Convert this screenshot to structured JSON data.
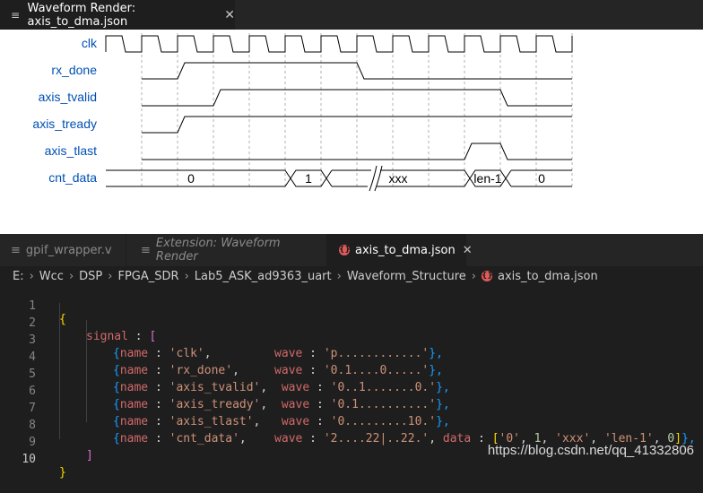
{
  "top_tab": {
    "icon": "preview-icon",
    "title": "Waveform Render: axis_to_dma.json",
    "close": "✕"
  },
  "waveform": {
    "signals": [
      "clk",
      "rx_done",
      "axis_tvalid",
      "axis_tready",
      "axis_tlast",
      "cnt_data"
    ],
    "data_labels": [
      "0",
      "1",
      "xxx",
      "len-1",
      "0"
    ]
  },
  "editor_tabs": [
    {
      "title": "gpif_wrapper.v",
      "icon": "file-lines-icon",
      "style": "inactive"
    },
    {
      "title": "Extension: Waveform Render",
      "icon": "extension-icon",
      "style": "italic"
    },
    {
      "title": "axis_to_dma.json",
      "icon": "json-file-icon",
      "style": "active",
      "close": "✕"
    }
  ],
  "breadcrumb": [
    "E:",
    "Wcc",
    "DSP",
    "FPGA_SDR",
    "Lab5_ASK_ad9363_uart",
    "Waveform_Structure",
    "axis_to_dma.json"
  ],
  "code": {
    "line_numbers": [
      "1",
      "2",
      "3",
      "4",
      "5",
      "6",
      "7",
      "8",
      "9",
      "10"
    ],
    "current_line": 10,
    "l1": "{",
    "l2_key": "signal",
    "l2_colon": " : ",
    "l2_open": "[",
    "rows": [
      {
        "open": "{",
        "name_key": "name",
        "colon": " : ",
        "name_val": "'clk'",
        "pad": ",         ",
        "wave_key": "wave",
        "wave_val": "'p............'",
        "end": "},"
      },
      {
        "open": "{",
        "name_key": "name",
        "colon": " : ",
        "name_val": "'rx_done'",
        "pad": ",     ",
        "wave_key": "wave",
        "wave_val": "'0.1....0.....'",
        "end": "},"
      },
      {
        "open": "{",
        "name_key": "name",
        "colon": " : ",
        "name_val": "'axis_tvalid'",
        "pad": ",  ",
        "wave_key": "wave",
        "wave_val": "'0..1.......0.'",
        "end": "},"
      },
      {
        "open": "{",
        "name_key": "name",
        "colon": " : ",
        "name_val": "'axis_tready'",
        "pad": ",  ",
        "wave_key": "wave",
        "wave_val": "'0.1..........'",
        "end": "},"
      },
      {
        "open": "{",
        "name_key": "name",
        "colon": " : ",
        "name_val": "'axis_tlast'",
        "pad": ",   ",
        "wave_key": "wave",
        "wave_val": "'0.........10.'",
        "end": "},"
      }
    ],
    "l8": {
      "open": "{",
      "name_key": "name",
      "colon": " : ",
      "name_val": "'cnt_data'",
      "pad": ",    ",
      "wave_key": "wave",
      "wave_val": "'2....22|..22.'",
      "data_key": "data",
      "d_open": "[",
      "d0": "'0'",
      "d1": "1",
      "d2": "'xxx'",
      "d3": "'len-1'",
      "d4": "0",
      "d_close": "]",
      "end": "},"
    },
    "l9": "]",
    "l10": "}"
  },
  "watermark": "https://blog.csdn.net/qq_41332806",
  "colors": {
    "signal_label": "#0050b4",
    "wave_bg": "#ffffff",
    "editor_bg": "#1e1e1e",
    "string": "#ce9178",
    "key": "#d16969"
  }
}
